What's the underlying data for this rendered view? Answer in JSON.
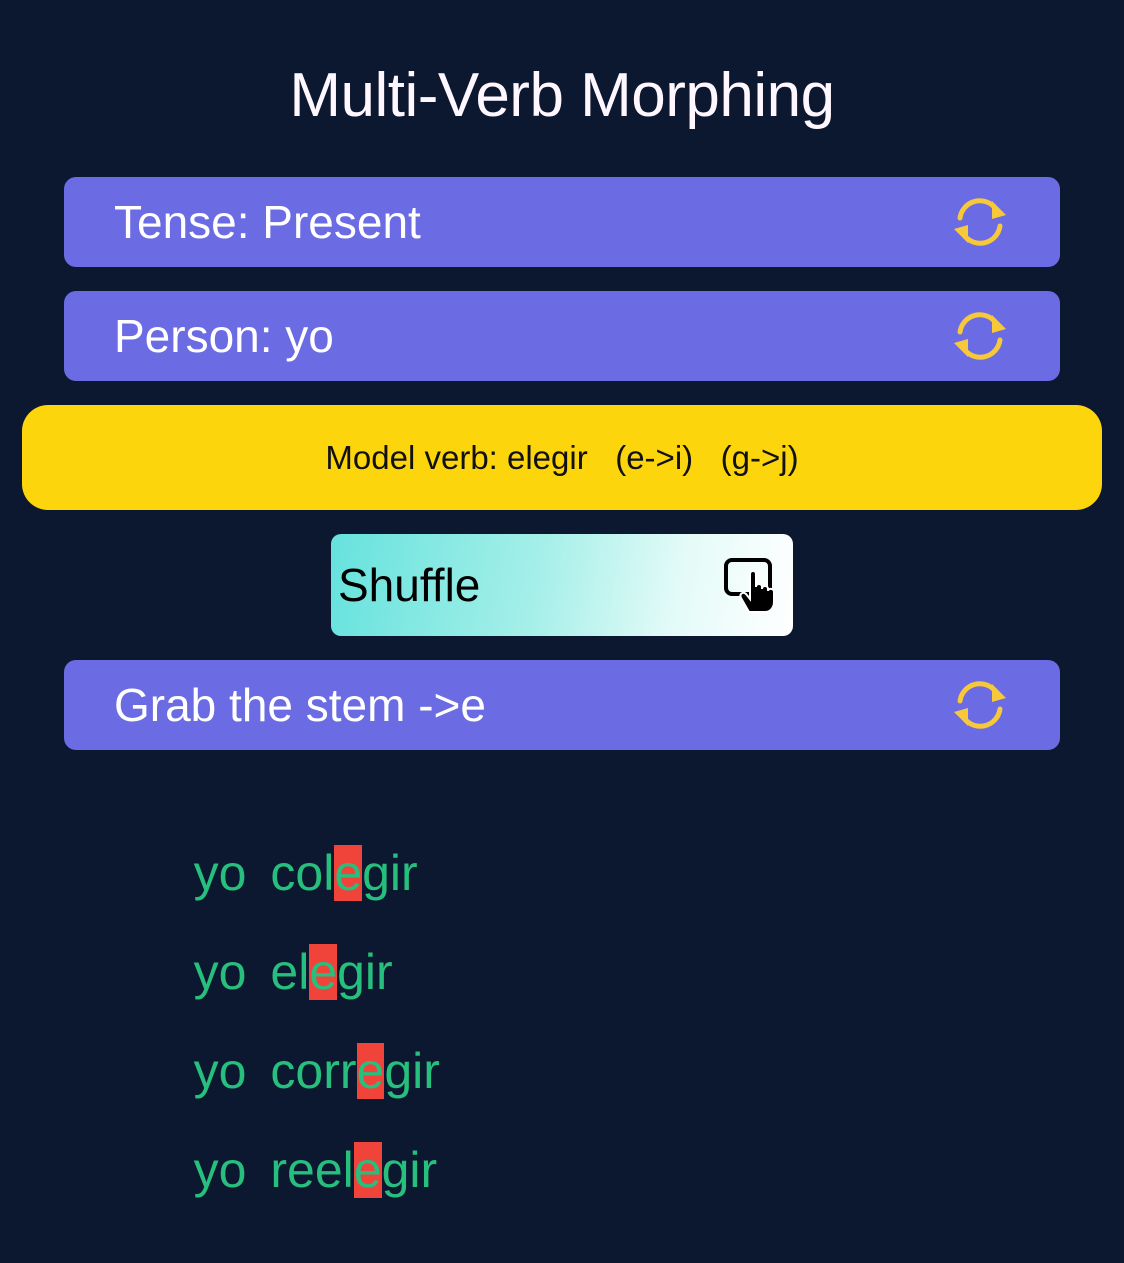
{
  "title": "Multi-Verb Morphing",
  "tense": {
    "label": "Tense: Present",
    "icon": "refresh-cycle-icon"
  },
  "person": {
    "label": "Person: yo",
    "icon": "refresh-cycle-icon"
  },
  "model_verb": {
    "label": "Model verb: elegir   (e->i)   (g->j)"
  },
  "shuffle": {
    "label": "Shuffle",
    "icon": "tap-screen-icon"
  },
  "task": {
    "label": "Grab the stem ->e",
    "icon": "refresh-cycle-icon"
  },
  "colors": {
    "background": "#0c1730",
    "bar": "#6b6be3",
    "model_bar": "#fdd50d",
    "verb_text": "#27bf7d",
    "highlight": "#f0443a",
    "cycle_icon": "#f7c93a"
  },
  "verbs": [
    {
      "pronoun": "yo",
      "before": "col",
      "highlight": "e",
      "after": "gir"
    },
    {
      "pronoun": "yo",
      "before": "el",
      "highlight": "e",
      "after": "gir"
    },
    {
      "pronoun": "yo",
      "before": "corr",
      "highlight": "e",
      "after": "gir"
    },
    {
      "pronoun": "yo",
      "before": "reel",
      "highlight": "e",
      "after": "gir"
    }
  ]
}
